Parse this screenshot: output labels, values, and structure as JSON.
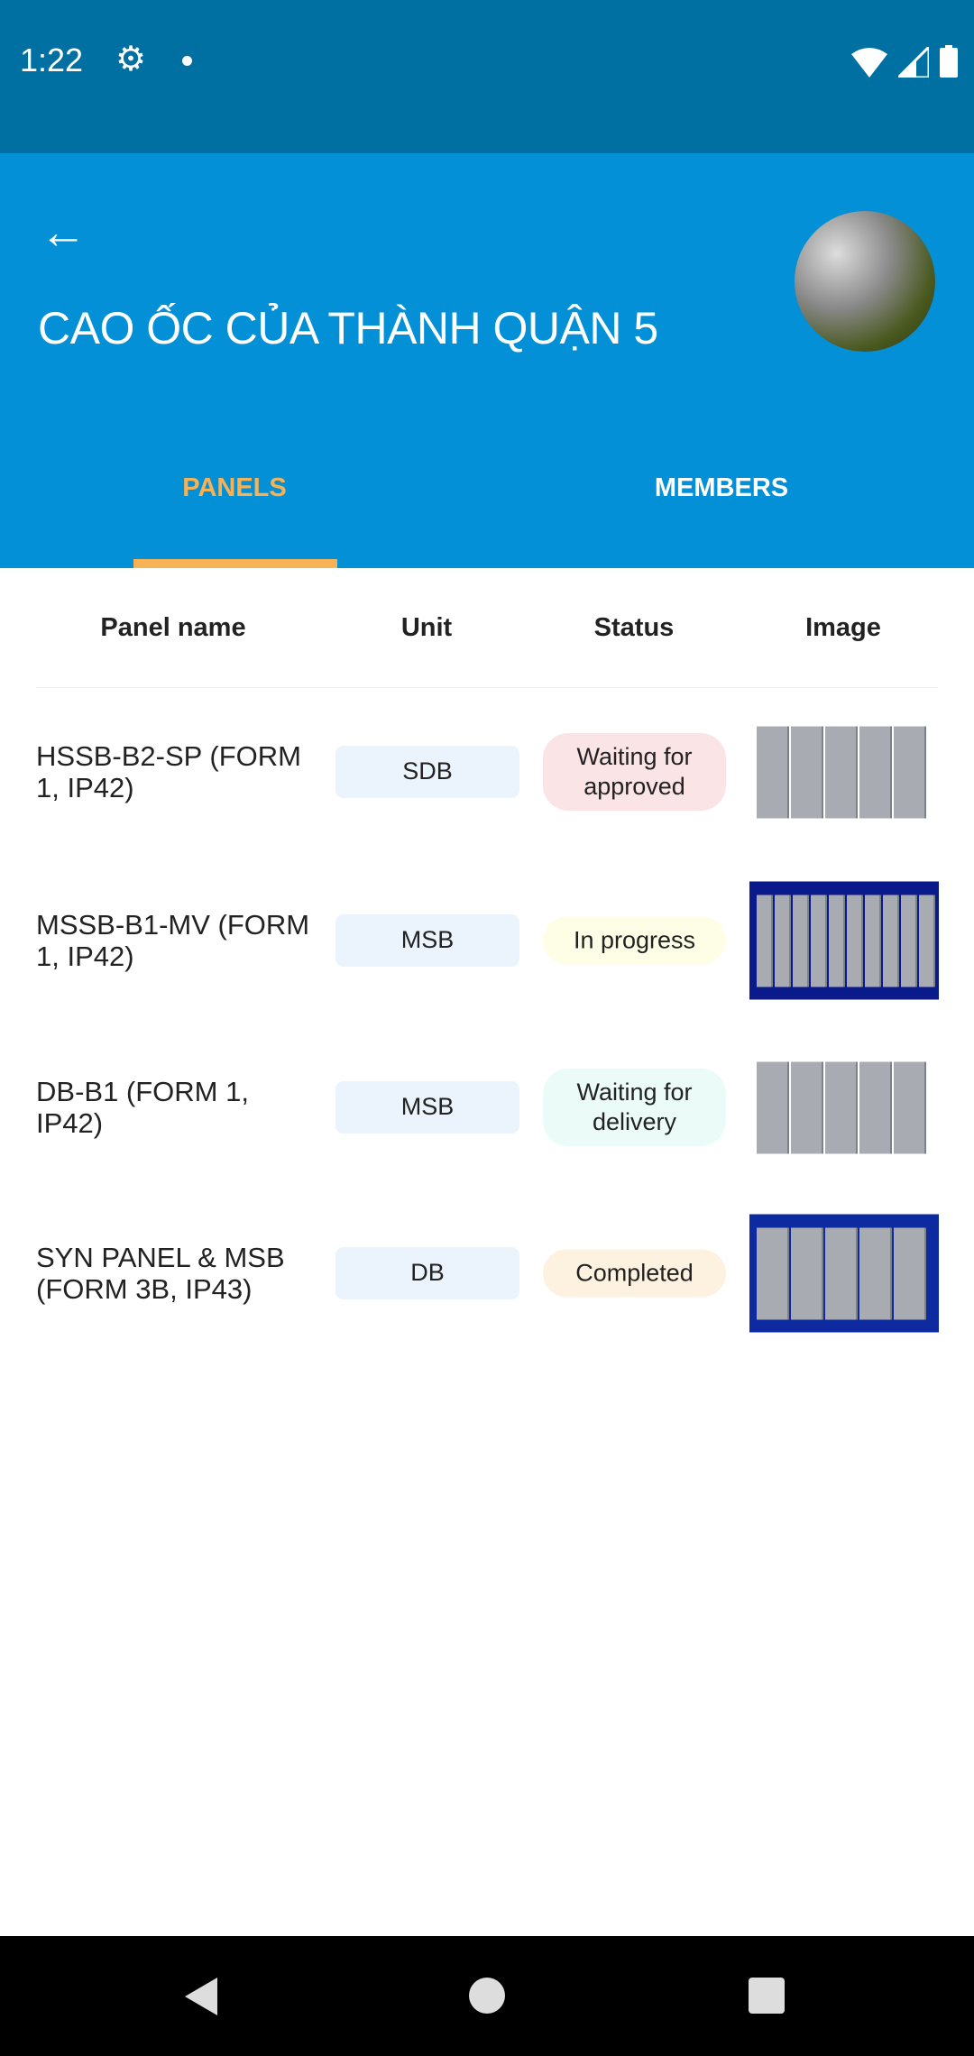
{
  "status_bar": {
    "time": "1:22",
    "icons": [
      "gear-icon",
      "notification-dot",
      "wifi-icon",
      "signal-icon",
      "battery-icon"
    ]
  },
  "header": {
    "title": "CAO ỐC CỦA THÀNH QUẬN 5",
    "back_icon": "arrow-left-icon",
    "background_color": "#0390d6",
    "status_bar_color": "#006fa1"
  },
  "tabs": [
    {
      "label": "PANELS",
      "active": true
    },
    {
      "label": "MEMBERS",
      "active": false
    }
  ],
  "accent_color": "#f6b255",
  "table": {
    "columns": [
      "Panel name",
      "Unit",
      "Status",
      "Image"
    ],
    "rows": [
      {
        "name": "HSSB-B2-SP (FORM 1, IP42)",
        "unit": "SDB",
        "status": "Waiting for approved",
        "status_color": "#fbe4e6"
      },
      {
        "name": "MSSB-B1-MV (FORM 1, IP42)",
        "unit": "MSB",
        "status": "In progress",
        "status_color": "#fefde6"
      },
      {
        "name": "DB-B1 (FORM 1, IP42)",
        "unit": "MSB",
        "status": "Waiting for delivery",
        "status_color": "#ebfbf7"
      },
      {
        "name": "SYN PANEL & MSB (FORM 3B, IP43)",
        "unit": "DB",
        "status": "Completed",
        "status_color": "#fdf1e0"
      }
    ]
  },
  "nav_bar": {
    "icons": [
      "back-triangle-icon",
      "home-circle-icon",
      "recents-square-icon"
    ]
  }
}
